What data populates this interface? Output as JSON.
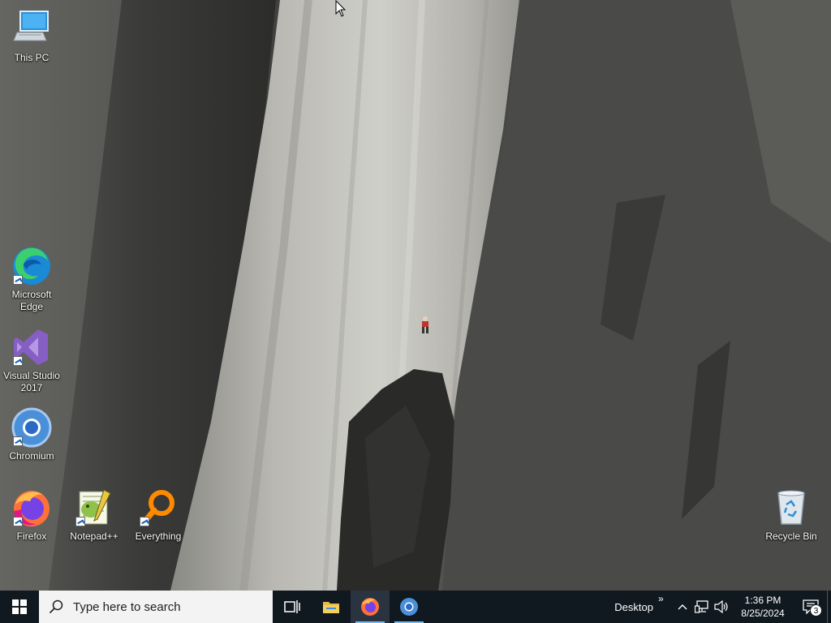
{
  "desktop": {
    "icons": [
      {
        "label": "This PC",
        "icon": "this-pc-icon"
      },
      {
        "label": "Microsoft Edge",
        "icon": "edge-icon"
      },
      {
        "label": "Visual Studio 2017",
        "icon": "visual-studio-icon"
      },
      {
        "label": "Chromium",
        "icon": "chromium-icon"
      },
      {
        "label": "Firefox",
        "icon": "firefox-icon"
      },
      {
        "label": "Notepad++",
        "icon": "notepadpp-icon"
      },
      {
        "label": "Everything",
        "icon": "everything-icon"
      },
      {
        "label": "Recycle Bin",
        "icon": "recycle-bin-icon"
      }
    ]
  },
  "taskbar": {
    "search_placeholder": "Type here to search",
    "pinned": [
      {
        "icon": "task-view-icon"
      },
      {
        "icon": "file-explorer-icon"
      },
      {
        "icon": "firefox-icon",
        "running": true
      },
      {
        "icon": "chromium-icon",
        "running": false
      }
    ],
    "toolbar_label": "Desktop",
    "toolbar_chevron": "»",
    "tray_icons": [
      "show-hidden-icons-chevron",
      "network-icon",
      "volume-icon"
    ],
    "clock": {
      "time": "1:36 PM",
      "date": "8/25/2024"
    },
    "notification_count": "3"
  },
  "colors": {
    "taskbar_bg": "#101820",
    "search_bg": "#f3f3f3",
    "accent": "#76b9ed"
  }
}
